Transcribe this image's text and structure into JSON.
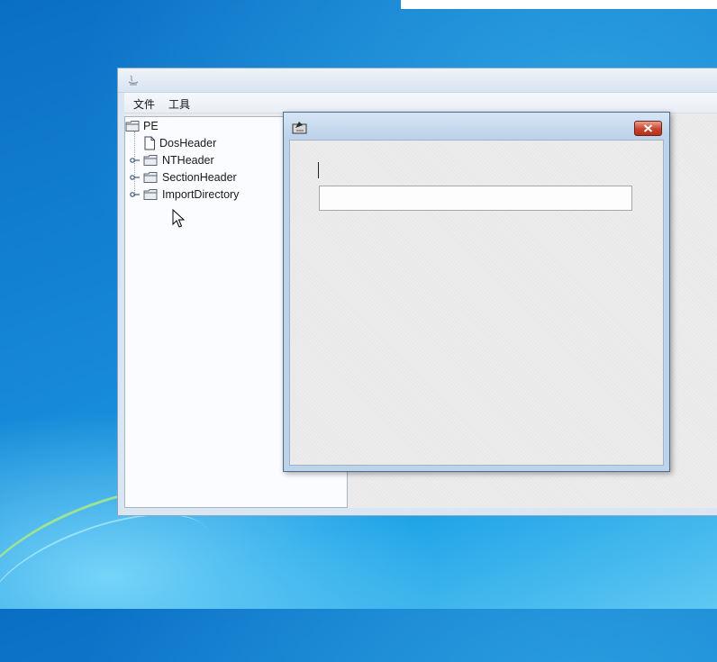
{
  "menubar": {
    "items": [
      "文件",
      "工具"
    ]
  },
  "tree": {
    "root": "PE",
    "children": [
      {
        "label": "DosHeader",
        "type": "leaf"
      },
      {
        "label": "NTHeader",
        "type": "folder"
      },
      {
        "label": "SectionHeader",
        "type": "folder"
      },
      {
        "label": "ImportDirectory",
        "type": "folder"
      }
    ]
  },
  "dialog": {
    "title": "",
    "input_value": "",
    "close_icon": "close-x"
  },
  "colors": {
    "close_button": "#c8442c",
    "title_bar": "#bcd3ea",
    "desktop": "#1687d6"
  }
}
